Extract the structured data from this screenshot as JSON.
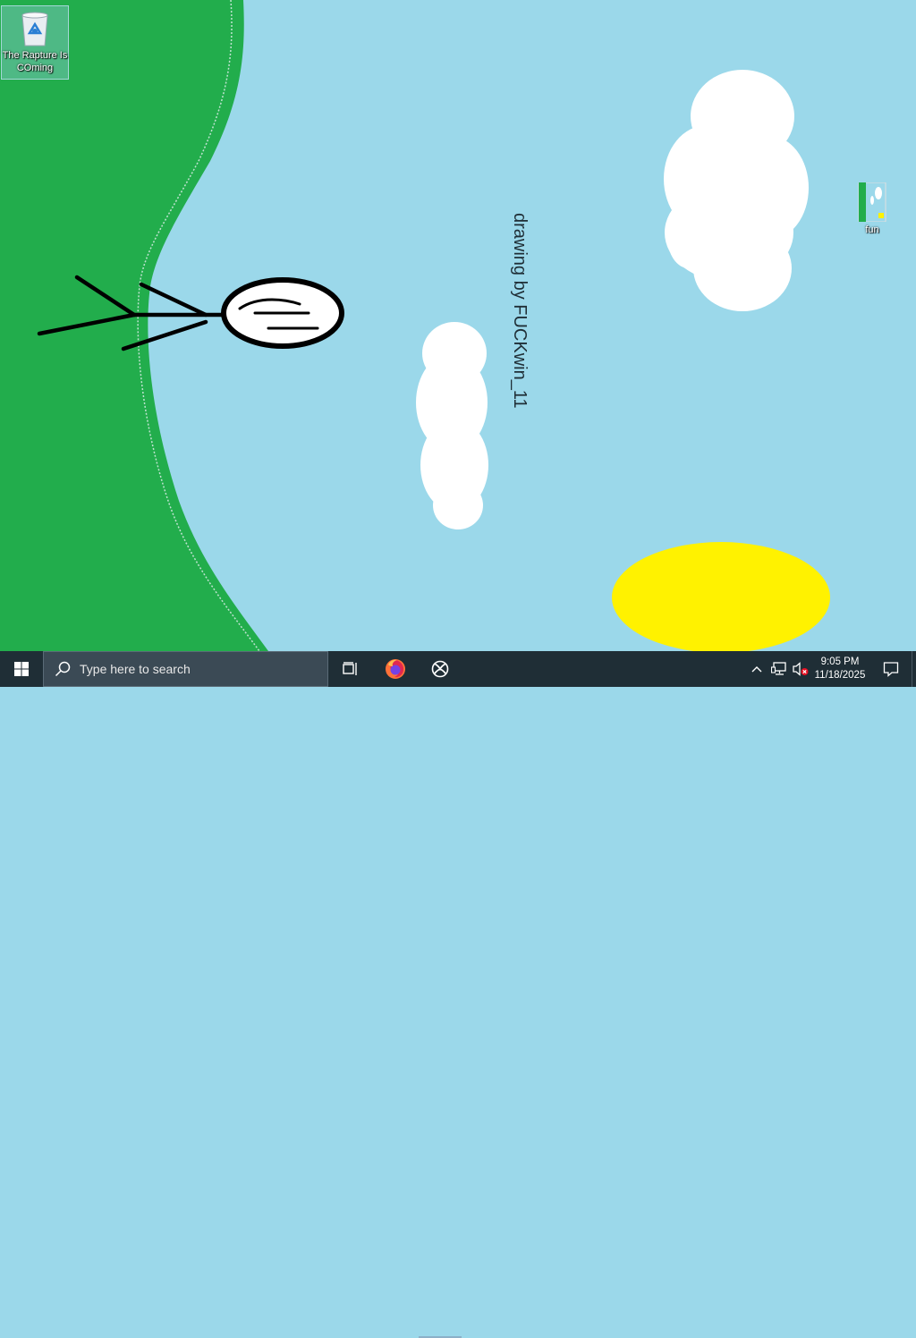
{
  "desktop": {
    "drawing_text": "drawing by FUCKwin_11",
    "icons": [
      {
        "label": "The Rapture Is COming",
        "icon": "recycle-bin-icon"
      },
      {
        "label": "fun",
        "icon": "image-file-icon"
      }
    ]
  },
  "taskbar": {
    "search_placeholder": "Type here to search",
    "pinned": [
      "task-view-icon",
      "firefox-icon",
      "xbox-icon"
    ],
    "clock": {
      "time": "9:05 PM",
      "date": "11/18/2025"
    }
  },
  "colors": {
    "sky": "#9bd8ea",
    "grass": "#22ad4c",
    "sun": "#fff200",
    "taskbar": "#1f2e36"
  }
}
